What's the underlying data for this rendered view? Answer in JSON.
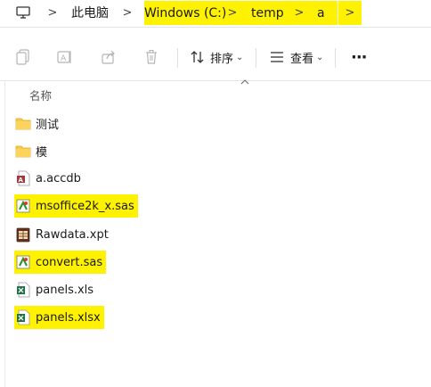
{
  "breadcrumb": {
    "items": [
      "此电脑",
      "Windows (C:)",
      "temp",
      "a"
    ],
    "separator": ">"
  },
  "toolbar": {
    "sort_label": "排序",
    "view_label": "查看",
    "more_label": "···"
  },
  "column": {
    "name_header": "名称"
  },
  "files": [
    {
      "name": "测试",
      "icon": "folder-icon"
    },
    {
      "name": "模",
      "icon": "folder-icon"
    },
    {
      "name": "a.accdb",
      "icon": "access-file-icon"
    },
    {
      "name": "msoffice2k_x.sas",
      "icon": "sas-file-icon"
    },
    {
      "name": "Rawdata.xpt",
      "icon": "xpt-file-icon"
    },
    {
      "name": "convert.sas",
      "icon": "sas-file-icon"
    },
    {
      "name": "panels.xls",
      "icon": "excel-file-icon"
    },
    {
      "name": "panels.xlsx",
      "icon": "excel-file-icon"
    }
  ],
  "colors": {
    "highlight": "#fff200",
    "folder": "#f8c94a",
    "excel": "#1e7145",
    "access": "#a4373a",
    "sas": "#2a8f2a"
  }
}
